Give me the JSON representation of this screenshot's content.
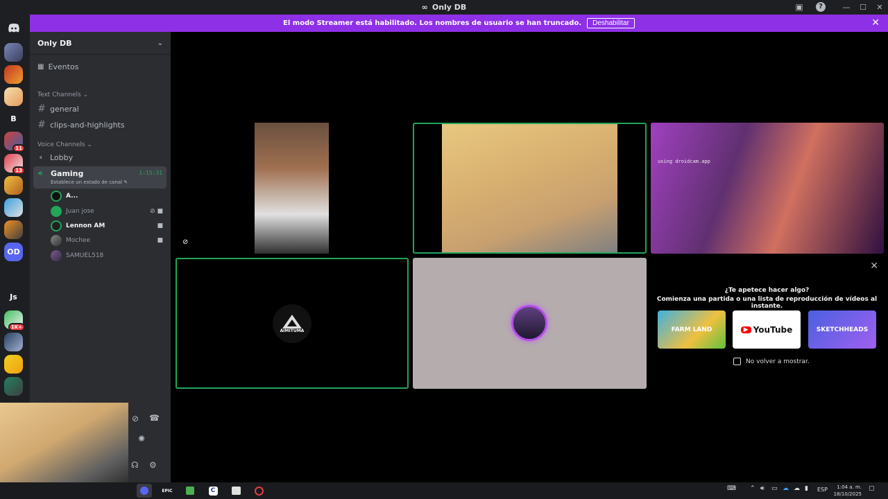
{
  "window": {
    "title": "Only DB",
    "help": "?",
    "minimize": "—",
    "maximize": "☐",
    "close": "✕"
  },
  "banner": {
    "text": "El modo Streamer está habilitado. Los nombres de usuario se han truncado.",
    "button": "Deshabilitar"
  },
  "guilds": {
    "b_label": "B",
    "od_label": "OD",
    "js_label": "Js",
    "badges": [
      "11",
      "13",
      "1K+"
    ]
  },
  "server": {
    "name": "Only DB",
    "events_label": "Eventos"
  },
  "categories": {
    "text": "Text Channels",
    "voice": "Voice Channels"
  },
  "text_channels": [
    "general",
    "clips-and-highlights"
  ],
  "voice_channels": {
    "lobby": "Lobby",
    "gaming": {
      "name": "Gaming",
      "timer": "1:15:31",
      "status": "Establece un estado de canal"
    }
  },
  "members": [
    "A...",
    "Juan jose",
    "Lennon AM",
    "Mochee",
    "SAMUEL518"
  ],
  "tiles": {
    "aimituma_label": "AIMITUMA",
    "watermark": "using droidcam.app"
  },
  "activity_popup": {
    "question": "¿Te apetece hacer algo?",
    "subtitle": "Comienza una partida o una lista de reproducción de vídeos al instante.",
    "activities": [
      "FARM LAND",
      "YouTube",
      "SKETCHHEADS"
    ],
    "checkbox_label": "No volver a mostrar."
  },
  "taskbar": {
    "lang": "ESP",
    "time": "1:04 a. m.",
    "date": "18/10/2025",
    "epic_label": "EPIC",
    "c_label": "C"
  },
  "colors": {
    "accent": "#8e30e6",
    "speaking": "#23a55a",
    "badge": "#f23f43"
  }
}
